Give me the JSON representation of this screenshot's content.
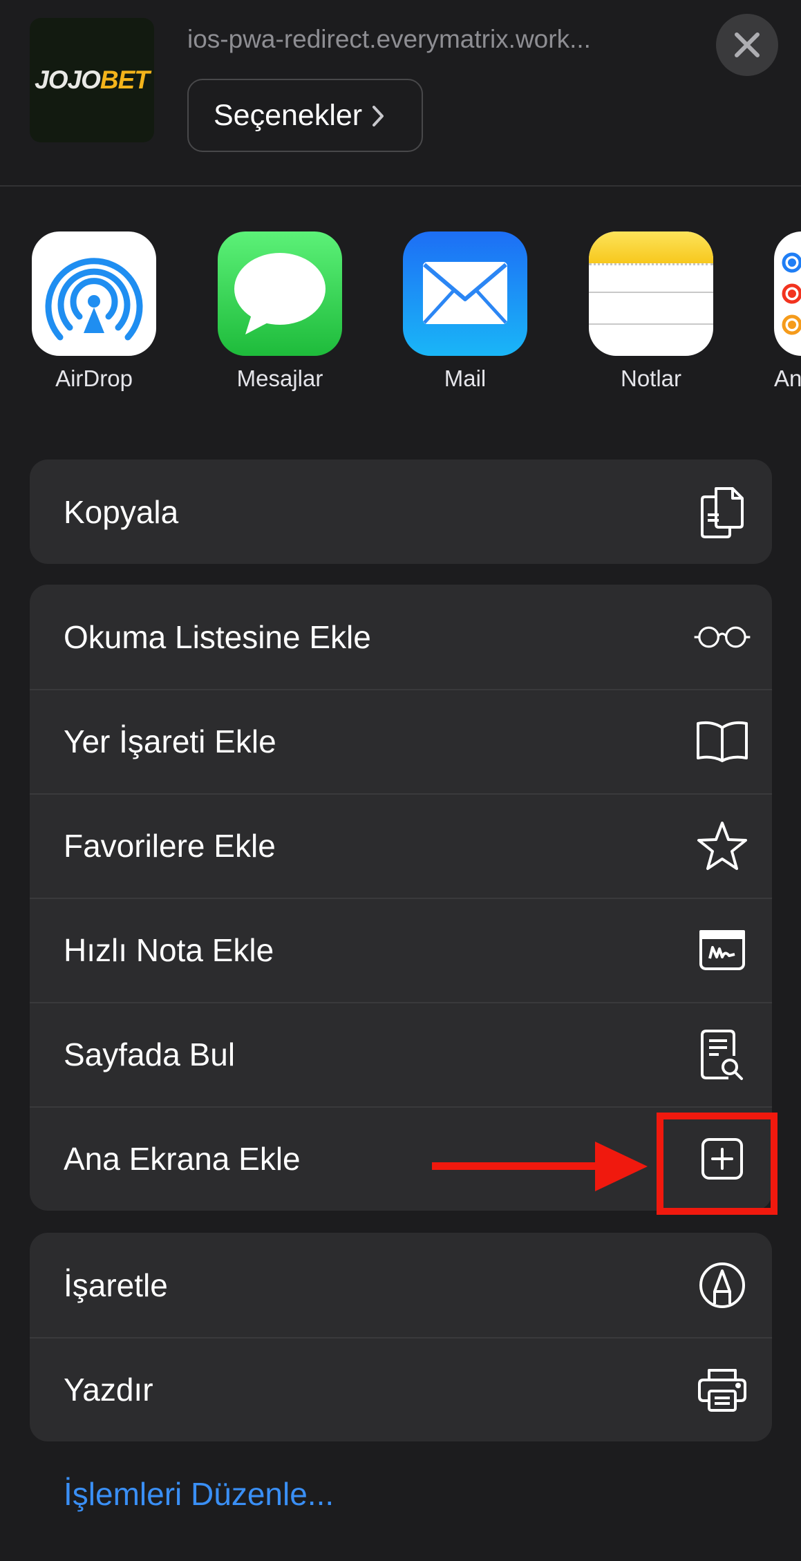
{
  "header": {
    "thumbnail": {
      "logo_part1": "JOJO",
      "logo_part2": "BET",
      "logo_colors": [
        "#e9e9e6",
        "#f4b41b"
      ]
    },
    "url": "ios-pwa-redirect.everymatrix.work...",
    "options_label": "Seçenekler",
    "close_icon": "xmark-icon"
  },
  "apps": [
    {
      "label": "AirDrop",
      "icon": "airdrop-icon"
    },
    {
      "label": "Mesajlar",
      "icon": "messages-icon"
    },
    {
      "label": "Mail",
      "icon": "mail-icon"
    },
    {
      "label": "Notlar",
      "icon": "notes-icon"
    },
    {
      "label": "Anı",
      "icon": "reminders-icon"
    }
  ],
  "actions": {
    "group1": [
      {
        "label": "Kopyala",
        "icon": "copy-icon"
      }
    ],
    "group2": [
      {
        "label": "Okuma Listesine Ekle",
        "icon": "glasses-icon"
      },
      {
        "label": "Yer İşareti Ekle",
        "icon": "book-icon"
      },
      {
        "label": "Favorilere Ekle",
        "icon": "star-icon"
      },
      {
        "label": "Hızlı Nota Ekle",
        "icon": "quick-note-icon"
      },
      {
        "label": "Sayfada Bul",
        "icon": "find-in-page-icon"
      },
      {
        "label": "Ana Ekrana Ekle",
        "icon": "add-square-icon"
      }
    ],
    "group3": [
      {
        "label": "İşaretle",
        "icon": "markup-icon"
      },
      {
        "label": "Yazdır",
        "icon": "printer-icon"
      }
    ]
  },
  "edit_actions_label": "İşlemleri Düzenle...",
  "colors": {
    "background": "#1c1c1e",
    "card": "#2c2c2e",
    "link": "#3a8ff5",
    "annotation": "#f0190e"
  }
}
